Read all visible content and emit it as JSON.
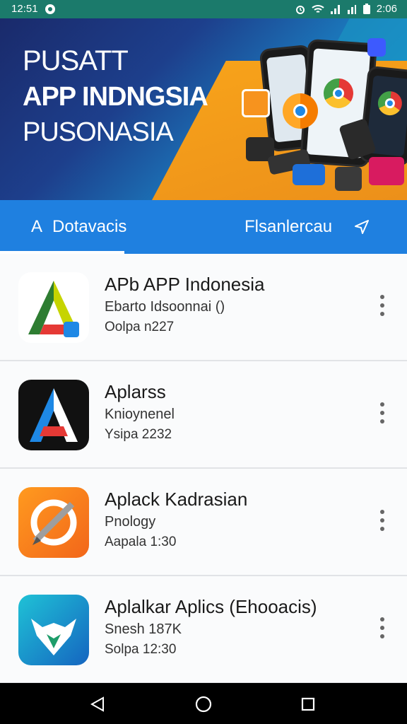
{
  "status_bar": {
    "time_left": "12:51",
    "time_right": "2:06"
  },
  "hero": {
    "line1": "PUSATT",
    "line2": "APP INDNGSIA",
    "line3": "PUSONASIA"
  },
  "tabs": {
    "left_prefix": "A",
    "left_label": "Dotavacis",
    "right_label": "Flsanlercau"
  },
  "apps": [
    {
      "title": "APb APP Indonesia",
      "subtitle": "Ebarto Idsoonnai ()",
      "meta": "Oolpa n227",
      "icon": "triangle-a-icon"
    },
    {
      "title": "Aplarss",
      "subtitle": "Knioynenel",
      "meta": "Ysipa 2232",
      "icon": "letter-a-icon"
    },
    {
      "title": "Aplack Kadrasian",
      "subtitle": "Pnology",
      "meta": "Aapala 1:30",
      "icon": "no-pen-icon"
    },
    {
      "title": "Aplalkar Aplics (Ehooacis)",
      "subtitle": "Snesh 187K",
      "meta": "Solpa 12:30",
      "icon": "fox-icon"
    }
  ],
  "colors": {
    "status_bar": "#1b7a6b",
    "tab_bar": "#1f80e0",
    "hero_blue": "#1a2a6b",
    "hero_orange": "#f7a21a"
  }
}
